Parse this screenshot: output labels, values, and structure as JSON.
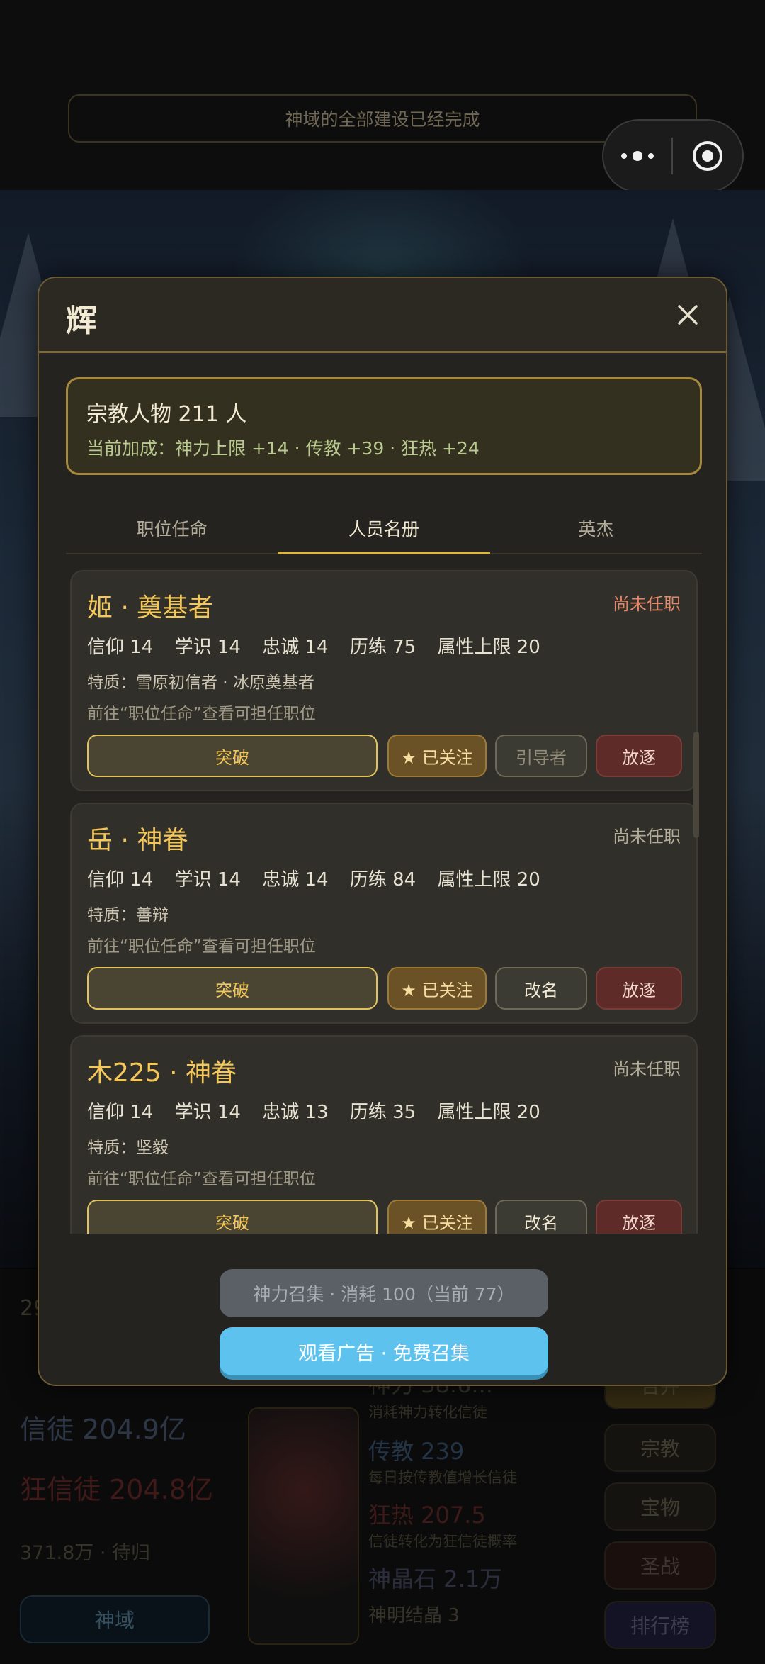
{
  "system": {
    "notice": "神域的全部建设已经完成",
    "icons": [
      "more-icon",
      "close-miniprogram-icon"
    ]
  },
  "background": {
    "partial_number": "29",
    "believers_label": "信徒 204.9亿",
    "zealots_label": "狂信徒 204.8亿",
    "pending_label": "371.8万 · 待归",
    "home_button": "神域",
    "top_stat_partial": "神力 38.6...",
    "stats": [
      {
        "label": "传教 239",
        "sub": "每日按传教值增长信徒"
      },
      {
        "label": "狂热 207.5",
        "sub": "信徒转化为狂信徒概率"
      },
      {
        "label": "神晶石 2.1万",
        "sub": "神明结晶 3"
      }
    ],
    "partial_sub": "消耗神力转化信徒",
    "right_buttons": [
      "宗教",
      "宝物",
      "圣战",
      "排行榜"
    ],
    "right_top_partial": "合并",
    "colors": {
      "believers": "#5a6b8c",
      "zealots": "#7a3030"
    }
  },
  "modal": {
    "title": "辉",
    "close_icon": "close-icon",
    "summary": {
      "count": "宗教人物 211 人",
      "bonus": "当前加成：神力上限 +14  ·  传教 +39  ·  狂热 +24"
    },
    "tabs": [
      {
        "label": "职位任命",
        "active": false
      },
      {
        "label": "人员名册",
        "active": true
      },
      {
        "label": "英杰",
        "active": false
      }
    ],
    "people": [
      {
        "name": "姬 · 奠基者",
        "status": "尚未任职",
        "status_warn": true,
        "attrs": [
          "信仰 14",
          "学识 14",
          "忠诚 14",
          "历练 75",
          "属性上限 20"
        ],
        "traits": "特质：雪原初信者 · 冰原奠基者",
        "hint": "前往“职位任命”查看可担任职位",
        "btn_break": "突破",
        "btn_follow": "★ 已关注",
        "btn_mid": "引导者",
        "btn_mid_disabled": true,
        "btn_exile": "放逐"
      },
      {
        "name": "岳 · 神眷",
        "status": "尚未任职",
        "status_warn": false,
        "attrs": [
          "信仰 14",
          "学识 14",
          "忠诚 14",
          "历练 84",
          "属性上限 20"
        ],
        "traits": "特质：善辩",
        "hint": "前往“职位任命”查看可担任职位",
        "btn_break": "突破",
        "btn_follow": "★ 已关注",
        "btn_mid": "改名",
        "btn_mid_disabled": false,
        "btn_exile": "放逐"
      },
      {
        "name": "木225 · 神眷",
        "status": "尚未任职",
        "status_warn": false,
        "attrs": [
          "信仰 14",
          "学识 14",
          "忠诚 13",
          "历练 35",
          "属性上限 20"
        ],
        "traits": "特质：坚毅",
        "hint": "前往“职位任命”查看可担任职位",
        "btn_break": "突破",
        "btn_follow": "★ 已关注",
        "btn_mid": "改名",
        "btn_mid_disabled": false,
        "btn_exile": "放逐"
      }
    ],
    "summon_cost": "神力召集 · 消耗 100（当前 77）",
    "summon_ad": "观看广告 · 免费召集"
  }
}
